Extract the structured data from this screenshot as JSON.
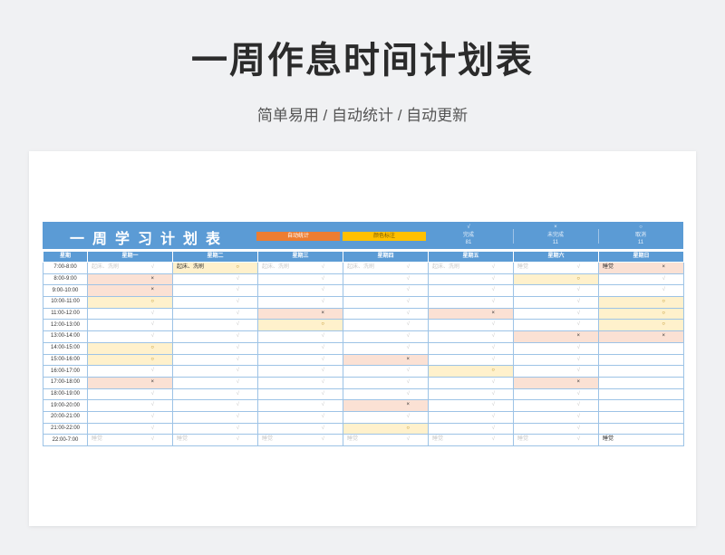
{
  "title": "一周作息时间计划表",
  "subtitle": "简单易用 / 自动统计 / 自动更新",
  "sheet": {
    "banner_title": "一周学习计划表",
    "legend": {
      "auto": "自动统计",
      "color": "颜色标注"
    },
    "stats": [
      {
        "symbol": "√",
        "label": "完成",
        "value": "81"
      },
      {
        "symbol": "×",
        "label": "未完成",
        "value": "11"
      },
      {
        "symbol": "○",
        "label": "取消",
        "value": "11"
      }
    ],
    "corner_label": "星期",
    "days": [
      "星期一",
      "星期二",
      "星期三",
      "星期四",
      "星期五",
      "星期六",
      "星期日"
    ],
    "rows": [
      {
        "time": "7:00-8:00",
        "cells": [
          {
            "t": "起床、洗刷",
            "m": "√",
            "s": "done",
            "f": true
          },
          {
            "t": "起床、洗刷",
            "m": "○",
            "s": "o"
          },
          {
            "t": "起床、洗刷",
            "m": "√",
            "s": "done",
            "f": true
          },
          {
            "t": "起床、洗刷",
            "m": "√",
            "s": "done",
            "f": true
          },
          {
            "t": "起床、洗刷",
            "m": "√",
            "s": "done",
            "f": true
          },
          {
            "t": "睡觉",
            "m": "√",
            "s": "done",
            "f": true
          },
          {
            "t": "睡觉",
            "m": "×",
            "s": "x"
          }
        ]
      },
      {
        "time": "8:00-9:00",
        "cells": [
          {
            "t": "",
            "m": "×",
            "s": "x"
          },
          {
            "t": "",
            "m": "√",
            "s": "done"
          },
          {
            "t": "",
            "m": "√",
            "s": "done"
          },
          {
            "t": "",
            "m": "√",
            "s": "done"
          },
          {
            "t": "",
            "m": "√",
            "s": "done"
          },
          {
            "t": "",
            "m": "○",
            "s": "o"
          },
          {
            "t": "",
            "m": "√",
            "s": "done"
          }
        ]
      },
      {
        "time": "9:00-10:00",
        "cells": [
          {
            "t": "",
            "m": "×",
            "s": "x"
          },
          {
            "t": "",
            "m": "√",
            "s": "done"
          },
          {
            "t": "",
            "m": "√",
            "s": "done"
          },
          {
            "t": "",
            "m": "√",
            "s": "done"
          },
          {
            "t": "",
            "m": "√",
            "s": "done"
          },
          {
            "t": "",
            "m": "√",
            "s": "done"
          },
          {
            "t": "",
            "m": "√",
            "s": "done"
          }
        ]
      },
      {
        "time": "10:00-11:00",
        "cells": [
          {
            "t": "",
            "m": "○",
            "s": "o"
          },
          {
            "t": "",
            "m": "√",
            "s": "done"
          },
          {
            "t": "",
            "m": "√",
            "s": "done"
          },
          {
            "t": "",
            "m": "√",
            "s": "done"
          },
          {
            "t": "",
            "m": "√",
            "s": "done"
          },
          {
            "t": "",
            "m": "√",
            "s": "done"
          },
          {
            "t": "",
            "m": "○",
            "s": "o"
          }
        ]
      },
      {
        "time": "11:00-12:00",
        "cells": [
          {
            "t": "",
            "m": "√",
            "s": "done"
          },
          {
            "t": "",
            "m": "√",
            "s": "done"
          },
          {
            "t": "",
            "m": "×",
            "s": "x"
          },
          {
            "t": "",
            "m": "√",
            "s": "done"
          },
          {
            "t": "",
            "m": "×",
            "s": "x"
          },
          {
            "t": "",
            "m": "√",
            "s": "done"
          },
          {
            "t": "",
            "m": "○",
            "s": "o"
          }
        ]
      },
      {
        "time": "12:00-13:00",
        "cells": [
          {
            "t": "",
            "m": "√",
            "s": "done"
          },
          {
            "t": "",
            "m": "√",
            "s": "done"
          },
          {
            "t": "",
            "m": "○",
            "s": "o"
          },
          {
            "t": "",
            "m": "√",
            "s": "done"
          },
          {
            "t": "",
            "m": "√",
            "s": "done"
          },
          {
            "t": "",
            "m": "√",
            "s": "done"
          },
          {
            "t": "",
            "m": "○",
            "s": "o"
          }
        ]
      },
      {
        "time": "13:00-14:00",
        "cells": [
          {
            "t": "",
            "m": "√",
            "s": "done"
          },
          {
            "t": "",
            "m": "√",
            "s": "done"
          },
          {
            "t": "",
            "m": "√",
            "s": "done"
          },
          {
            "t": "",
            "m": "√",
            "s": "done"
          },
          {
            "t": "",
            "m": "√",
            "s": "done"
          },
          {
            "t": "",
            "m": "×",
            "s": "x"
          },
          {
            "t": "",
            "m": "×",
            "s": "x"
          }
        ]
      },
      {
        "time": "14:00-15:00",
        "cells": [
          {
            "t": "",
            "m": "○",
            "s": "o"
          },
          {
            "t": "",
            "m": "√",
            "s": "done"
          },
          {
            "t": "",
            "m": "√",
            "s": "done"
          },
          {
            "t": "",
            "m": "√",
            "s": "done"
          },
          {
            "t": "",
            "m": "√",
            "s": "done"
          },
          {
            "t": "",
            "m": "√",
            "s": "done"
          },
          {
            "t": "",
            "m": "",
            "s": "done"
          }
        ]
      },
      {
        "time": "15:00-16:00",
        "cells": [
          {
            "t": "",
            "m": "○",
            "s": "o"
          },
          {
            "t": "",
            "m": "√",
            "s": "done"
          },
          {
            "t": "",
            "m": "√",
            "s": "done"
          },
          {
            "t": "",
            "m": "×",
            "s": "x"
          },
          {
            "t": "",
            "m": "√",
            "s": "done"
          },
          {
            "t": "",
            "m": "√",
            "s": "done"
          },
          {
            "t": "",
            "m": "",
            "s": "done"
          }
        ]
      },
      {
        "time": "16:00-17:00",
        "cells": [
          {
            "t": "",
            "m": "√",
            "s": "done"
          },
          {
            "t": "",
            "m": "√",
            "s": "done"
          },
          {
            "t": "",
            "m": "√",
            "s": "done"
          },
          {
            "t": "",
            "m": "√",
            "s": "done"
          },
          {
            "t": "",
            "m": "○",
            "s": "o"
          },
          {
            "t": "",
            "m": "√",
            "s": "done"
          },
          {
            "t": "",
            "m": "",
            "s": "done"
          }
        ]
      },
      {
        "time": "17:00-18:00",
        "cells": [
          {
            "t": "",
            "m": "×",
            "s": "x"
          },
          {
            "t": "",
            "m": "√",
            "s": "done"
          },
          {
            "t": "",
            "m": "√",
            "s": "done"
          },
          {
            "t": "",
            "m": "√",
            "s": "done"
          },
          {
            "t": "",
            "m": "√",
            "s": "done"
          },
          {
            "t": "",
            "m": "×",
            "s": "x"
          },
          {
            "t": "",
            "m": "",
            "s": "done"
          }
        ]
      },
      {
        "time": "18:00-19:00",
        "cells": [
          {
            "t": "",
            "m": "√",
            "s": "done"
          },
          {
            "t": "",
            "m": "√",
            "s": "done"
          },
          {
            "t": "",
            "m": "√",
            "s": "done"
          },
          {
            "t": "",
            "m": "√",
            "s": "done"
          },
          {
            "t": "",
            "m": "√",
            "s": "done"
          },
          {
            "t": "",
            "m": "√",
            "s": "done"
          },
          {
            "t": "",
            "m": "",
            "s": "done"
          }
        ]
      },
      {
        "time": "19:00-20:00",
        "cells": [
          {
            "t": "",
            "m": "√",
            "s": "done"
          },
          {
            "t": "",
            "m": "√",
            "s": "done"
          },
          {
            "t": "",
            "m": "√",
            "s": "done"
          },
          {
            "t": "",
            "m": "×",
            "s": "x"
          },
          {
            "t": "",
            "m": "√",
            "s": "done"
          },
          {
            "t": "",
            "m": "√",
            "s": "done"
          },
          {
            "t": "",
            "m": "",
            "s": "done"
          }
        ]
      },
      {
        "time": "20:00-21:00",
        "cells": [
          {
            "t": "",
            "m": "√",
            "s": "done"
          },
          {
            "t": "",
            "m": "√",
            "s": "done"
          },
          {
            "t": "",
            "m": "√",
            "s": "done"
          },
          {
            "t": "",
            "m": "√",
            "s": "done"
          },
          {
            "t": "",
            "m": "√",
            "s": "done"
          },
          {
            "t": "",
            "m": "√",
            "s": "done"
          },
          {
            "t": "",
            "m": "",
            "s": "done"
          }
        ]
      },
      {
        "time": "21:00-22:00",
        "cells": [
          {
            "t": "",
            "m": "√",
            "s": "done"
          },
          {
            "t": "",
            "m": "√",
            "s": "done"
          },
          {
            "t": "",
            "m": "√",
            "s": "done"
          },
          {
            "t": "",
            "m": "○",
            "s": "o"
          },
          {
            "t": "",
            "m": "√",
            "s": "done"
          },
          {
            "t": "",
            "m": "√",
            "s": "done"
          },
          {
            "t": "",
            "m": "",
            "s": "done"
          }
        ]
      },
      {
        "time": "22:00-7:00",
        "cells": [
          {
            "t": "睡觉",
            "m": "√",
            "s": "done",
            "f": true
          },
          {
            "t": "睡觉",
            "m": "√",
            "s": "done",
            "f": true
          },
          {
            "t": "睡觉",
            "m": "√",
            "s": "done",
            "f": true
          },
          {
            "t": "睡觉",
            "m": "√",
            "s": "done",
            "f": true
          },
          {
            "t": "睡觉",
            "m": "√",
            "s": "done",
            "f": true
          },
          {
            "t": "睡觉",
            "m": "√",
            "s": "done",
            "f": true
          },
          {
            "t": "睡觉",
            "m": "",
            "s": "done"
          }
        ]
      }
    ]
  }
}
